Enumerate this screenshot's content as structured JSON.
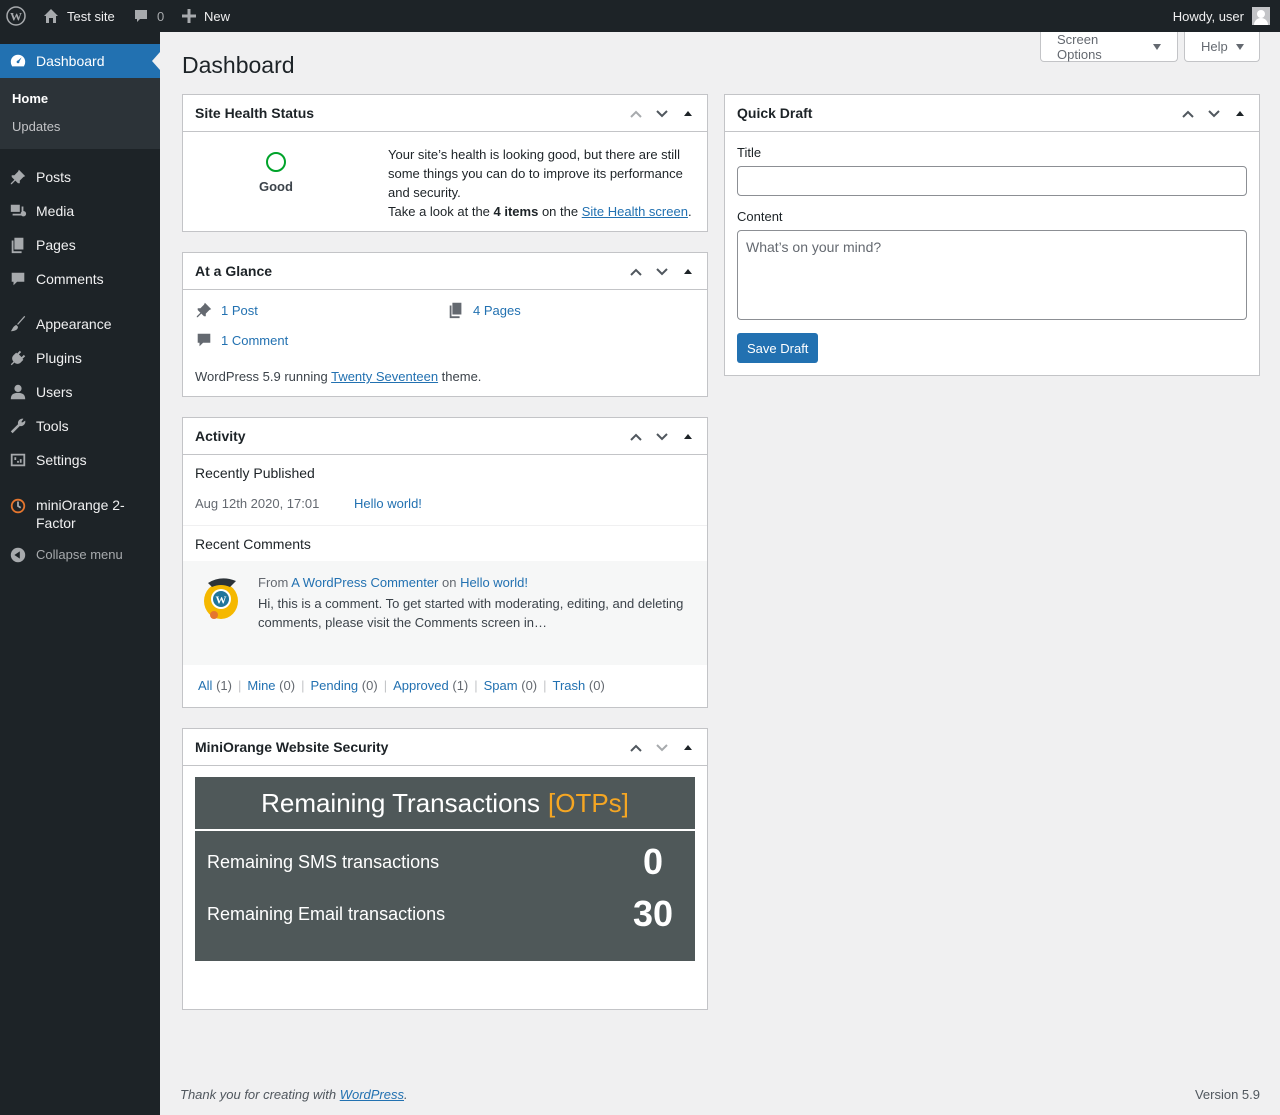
{
  "adminbar": {
    "site_name": "Test site",
    "comment_count": "0",
    "new_label": "New",
    "howdy": "Howdy, user"
  },
  "sidebar": {
    "dashboard": "Dashboard",
    "submenu": [
      "Home",
      "Updates"
    ],
    "items": [
      "Posts",
      "Media",
      "Pages",
      "Comments",
      "Appearance",
      "Plugins",
      "Users",
      "Tools",
      "Settings"
    ],
    "miniorange": "miniOrange 2-Factor",
    "collapse": "Collapse menu"
  },
  "header": {
    "title": "Dashboard",
    "screen_options": "Screen Options",
    "help": "Help"
  },
  "site_health": {
    "title": "Site Health Status",
    "status": "Good",
    "text": "Your site’s health is looking good, but there are still some things you can do to improve its performance and security.",
    "take_look_1": "Take a look at the ",
    "items_count": "4 items",
    "take_look_2": " on the ",
    "link": "Site Health screen",
    "period": "."
  },
  "glance": {
    "title": "At a Glance",
    "posts": "1 Post",
    "pages": "4 Pages",
    "comments": "1 Comment",
    "running_1": "WordPress 5.9 running ",
    "theme": "Twenty Seventeen",
    "running_2": " theme."
  },
  "activity": {
    "title": "Activity",
    "recently_published": "Recently Published",
    "date": "Aug 12th 2020, 17:01",
    "post_link": "Hello world!",
    "recent_comments": "Recent Comments",
    "from": "From ",
    "commenter": "A WordPress Commenter",
    "on": " on ",
    "comment_post": "Hello world!",
    "comment_text": "Hi, this is a comment. To get started with moderating, editing, and deleting comments, please visit the Comments screen in…",
    "filters": [
      {
        "label": "All",
        "count": "(1)"
      },
      {
        "label": "Mine",
        "count": "(0)"
      },
      {
        "label": "Pending",
        "count": "(0)"
      },
      {
        "label": "Approved",
        "count": "(1)"
      },
      {
        "label": "Spam",
        "count": "(0)"
      },
      {
        "label": "Trash",
        "count": "(0)"
      }
    ]
  },
  "security": {
    "title": "MiniOrange Website Security",
    "heading": "Remaining Transactions",
    "heading_accent": "[OTPs]",
    "sms_label": "Remaining SMS transactions",
    "sms_value": "0",
    "email_label": "Remaining Email transactions",
    "email_value": "30"
  },
  "quick_draft": {
    "title": "Quick Draft",
    "title_label": "Title",
    "title_value": "",
    "content_label": "Content",
    "content_placeholder": "What’s on your mind?",
    "save": "Save Draft"
  },
  "footer": {
    "thanks_1": "Thank you for creating with ",
    "wordpress": "WordPress",
    "thanks_2": ".",
    "version": "Version 5.9"
  },
  "colors": {
    "accent": "#2271b1",
    "adminbar": "#1d2327",
    "health_good": "#00a32a",
    "otp_accent": "#f5a623"
  }
}
